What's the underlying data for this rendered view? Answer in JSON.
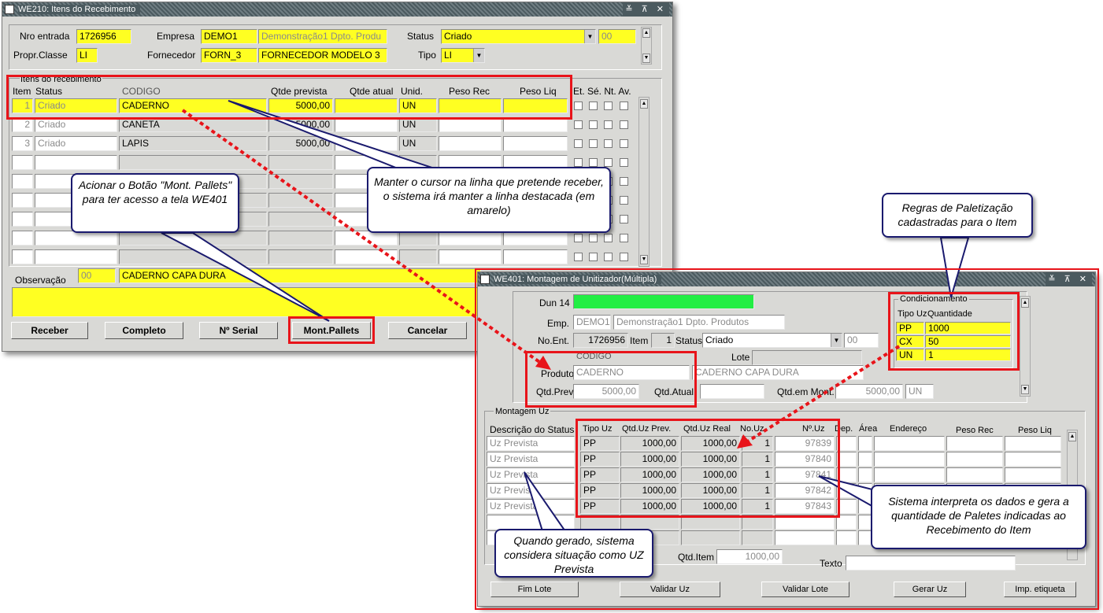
{
  "we210": {
    "title": "WE210: Itens do Recebimento",
    "title_buttons": "≚ ⊼ ✕",
    "nro_entrada_label": "Nro entrada",
    "nro_entrada": "1726956",
    "empresa_label": "Empresa",
    "empresa_code": "DEMO1",
    "empresa_name": "Demonstração1 Dpto. Produ",
    "status_label": "Status",
    "status_value": "Criado",
    "status_code": "00",
    "propr_label": "Propr.Classe",
    "propr_value": "LI",
    "fornecedor_label": "Fornecedor",
    "fornecedor_code": "FORN_3",
    "fornecedor_name": "FORNECEDOR MODELO 3",
    "tipo_label": "Tipo",
    "tipo_value": "LI",
    "group_label": "Itens do recebimento",
    "columns": {
      "item": "Item",
      "status": "Status",
      "codigo": "CODIGO",
      "qtde_prevista": "Qtde prevista",
      "qtde_atual": "Qtde atual",
      "unid": "Unid.",
      "peso_rec": "Peso Rec",
      "peso_liq": "Peso Liq",
      "flags": "Et. Sé. Nt. Av."
    },
    "rows": [
      {
        "item": "1",
        "status": "Criado",
        "codigo": "CADERNO",
        "qtde_prevista": "5000,00",
        "unid": "UN"
      },
      {
        "item": "2",
        "status": "Criado",
        "codigo": "CANETA",
        "qtde_prevista": "5000,00",
        "unid": "UN"
      },
      {
        "item": "3",
        "status": "Criado",
        "codigo": "LAPIS",
        "qtde_prevista": "5000,00",
        "unid": "UN"
      }
    ],
    "observacao_label": "Observação",
    "observacao_code": "00",
    "observacao_text": "CADERNO CAPA DURA",
    "buttons": {
      "receber": "Receber",
      "completo": "Completo",
      "serial": "Nº Serial",
      "mont_pallets": "Mont.Pallets",
      "cancelar": "Cancelar"
    }
  },
  "we401": {
    "title": "WE401: Montagem de Unitizador(Múltipla)",
    "title_buttons": "≚ ⊼ ✕",
    "dun_label": "Dun 14",
    "emp_label": "Emp.",
    "emp_code": "DEMO1",
    "emp_name": "Demonstração1 Dpto. Produtos",
    "noent_label": "No.Ent.",
    "noent_value": "1726956",
    "item_label": "Item",
    "item_value": "1",
    "status_label": "Status",
    "status_value": "Criado",
    "status_code": "00",
    "codigo_header": "CODIGO",
    "lote_label": "Lote",
    "produto_label": "Produto",
    "produto_code": "CADERNO",
    "produto_name": "CADERNO CAPA DURA",
    "qtdprev_label": "Qtd.Prev.",
    "qtdprev_value": "5000,00",
    "qtdatual_label": "Qtd.Atual",
    "qtdmont_label": "Qtd.em Mont.",
    "qtdmont_value": "5000,00",
    "qtdmont_unit": "UN",
    "cond_label": "Condicionamento",
    "cond_col_tipo": "Tipo Uz",
    "cond_col_qtd": "Quantidade",
    "cond_rows": [
      {
        "tipo": "PP",
        "qtd": "1000"
      },
      {
        "tipo": "CX",
        "qtd": "50"
      },
      {
        "tipo": "UN",
        "qtd": "1"
      }
    ],
    "montagem_label": "Montagem Uz",
    "columns": {
      "descricao": "Descrição do Status",
      "tipo": "Tipo Uz",
      "qtd_prev": "Qtd.Uz Prev.",
      "qtd_real": "Qtd.Uz Real",
      "no_uz": "No.Uz",
      "n_uz": "Nº.Uz",
      "dep": "Dep.",
      "area": "Área",
      "endereco": "Endereço",
      "peso_rec": "Peso Rec",
      "peso_liq": "Peso Liq"
    },
    "uz_rows": [
      {
        "descricao": "Uz Prevista",
        "tipo": "PP",
        "qtd_prev": "1000,00",
        "qtd_real": "1000,00",
        "no_uz": "1",
        "n_uz": "97839"
      },
      {
        "descricao": "Uz Prevista",
        "tipo": "PP",
        "qtd_prev": "1000,00",
        "qtd_real": "1000,00",
        "no_uz": "1",
        "n_uz": "97840"
      },
      {
        "descricao": "Uz Prevista",
        "tipo": "PP",
        "qtd_prev": "1000,00",
        "qtd_real": "1000,00",
        "no_uz": "1",
        "n_uz": "97841"
      },
      {
        "descricao": "Uz Prevista",
        "tipo": "PP",
        "qtd_prev": "1000,00",
        "qtd_real": "1000,00",
        "no_uz": "1",
        "n_uz": "97842"
      },
      {
        "descricao": "Uz Prevista",
        "tipo": "PP",
        "qtd_prev": "1000,00",
        "qtd_real": "1000,00",
        "no_uz": "1",
        "n_uz": "97843"
      }
    ],
    "qtditem_label": "Qtd.Item",
    "qtditem_value": "1000,00",
    "texto_label": "Texto",
    "buttons": {
      "fim_lote": "Fim Lote",
      "validar_uz": "Validar Uz",
      "validar_lote": "Validar Lote",
      "gerar_uz": "Gerar Uz",
      "imp_etiqueta": "Imp. etiqueta"
    }
  },
  "callouts": {
    "mont_pallets": "Acionar o Botão \"Mont. Pallets\" para ter acesso a tela WE401",
    "cursor": "Manter o cursor na linha que pretende receber, o sistema irá manter a linha destacada (em amarelo)",
    "regras": "Regras de Paletização cadastradas para o Item",
    "interpreta": "Sistema interpreta os dados e gera a quantidade de Paletes indicadas ao Recebimento do Item",
    "gerado": "Quando gerado, sistema considera situação como UZ Prevista"
  },
  "colors": {
    "highlight": "#ffff22",
    "annotation_red": "#e8141a",
    "callout_border": "#1a1a6e",
    "titlebar": "#4b5a5f"
  }
}
